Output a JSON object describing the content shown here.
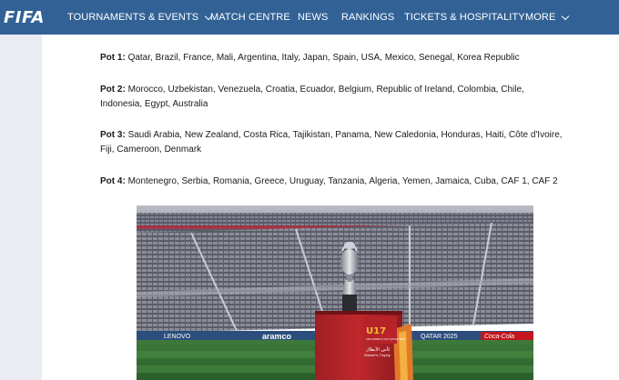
{
  "nav": {
    "logo": "FIFA",
    "items": [
      {
        "label": "TOURNAMENTS & EVENTS",
        "has_dropdown": true
      },
      {
        "label": "MATCH CENTRE",
        "has_dropdown": false
      },
      {
        "label": "NEWS",
        "has_dropdown": false
      },
      {
        "label": "RANKINGS",
        "has_dropdown": false
      },
      {
        "label": "TICKETS & HOSPITALITY",
        "has_dropdown": false
      },
      {
        "label": "MORE",
        "has_dropdown": true
      }
    ],
    "bg_color": "#326295"
  },
  "pots": [
    {
      "label": "Pot 1:",
      "teams": "Qatar, Brazil, France, Mali, Argentina, Italy, Japan, Spain, USA, Mexico, Senegal, Korea Republic"
    },
    {
      "label": "Pot 2:",
      "teams": "Morocco, Uzbekistan, Venezuela, Croatia, Ecuador, Belgium, Republic of Ireland, Colombia, Chile, Indonesia, Egypt, Australia"
    },
    {
      "label": "Pot 3:",
      "teams": "Saudi Arabia, New Zealand, Costa Rica, Tajikistan, Panama, New Caledonia, Honduras, Haiti, Côte d'Ivoire, Fiji, Cameroon, Denmark"
    },
    {
      "label": "Pot 4:",
      "teams": "Montenegro, Serbia, Romania, Greece, Uruguay, Tanzania, Algeria, Yemen, Jamaica, Cuba, CAF 1, CAF 2"
    }
  ],
  "photo": {
    "board_ads": [
      "LENOVO",
      "aramco",
      "QATAR 2025",
      "Coca-Cola"
    ],
    "trophy_box": {
      "logo_text": "U17",
      "logo_sub": "FIFA WORLD CUP QATAR 2025",
      "arabic": "كأس الأبطال",
      "caption": "Winner's Trophy"
    }
  }
}
